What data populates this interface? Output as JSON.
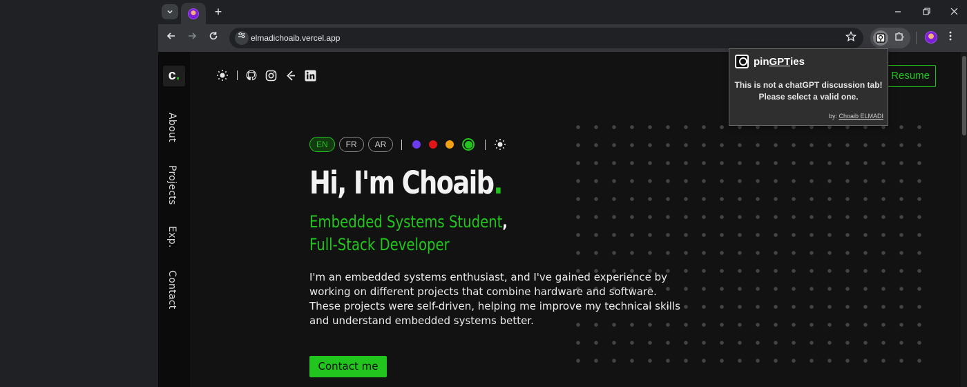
{
  "browser": {
    "url": "elmadichoaib.vercel.app",
    "tab_search_icon": "chevron-down-icon",
    "new_tab_label": "+"
  },
  "extension_popup": {
    "title_prefix": "pin",
    "title_gpt": "GPT",
    "title_suffix": "ies",
    "message_line1": "This is not a chatGPT discussion tab!",
    "message_line2": "Please select a valid one.",
    "by_label": "by:",
    "author": "Choaib ELMADI"
  },
  "site": {
    "logo": "c",
    "nav": [
      "About",
      "Projects",
      "Exp.",
      "Contact"
    ],
    "resume_label": "Resume",
    "languages": [
      "EN",
      "FR",
      "AR"
    ],
    "active_language": "EN",
    "theme_colors": [
      "#6c3bf0",
      "#e01616",
      "#f0a010",
      "#22c51e"
    ],
    "selected_color": "#22c51e",
    "headline": "Hi, I'm Choaib",
    "headline_period": ".",
    "subtitle_line1": "Embedded Systems Student",
    "subtitle_comma": ",",
    "subtitle_line2": "Full-Stack Developer",
    "bio": "I'm an embedded systems enthusiast, and I've gained experience by working on different projects that combine hardware and software. These projects were self-driven, helping me improve my technical skills and understand embedded systems better.",
    "contact_label": "Contact me"
  }
}
